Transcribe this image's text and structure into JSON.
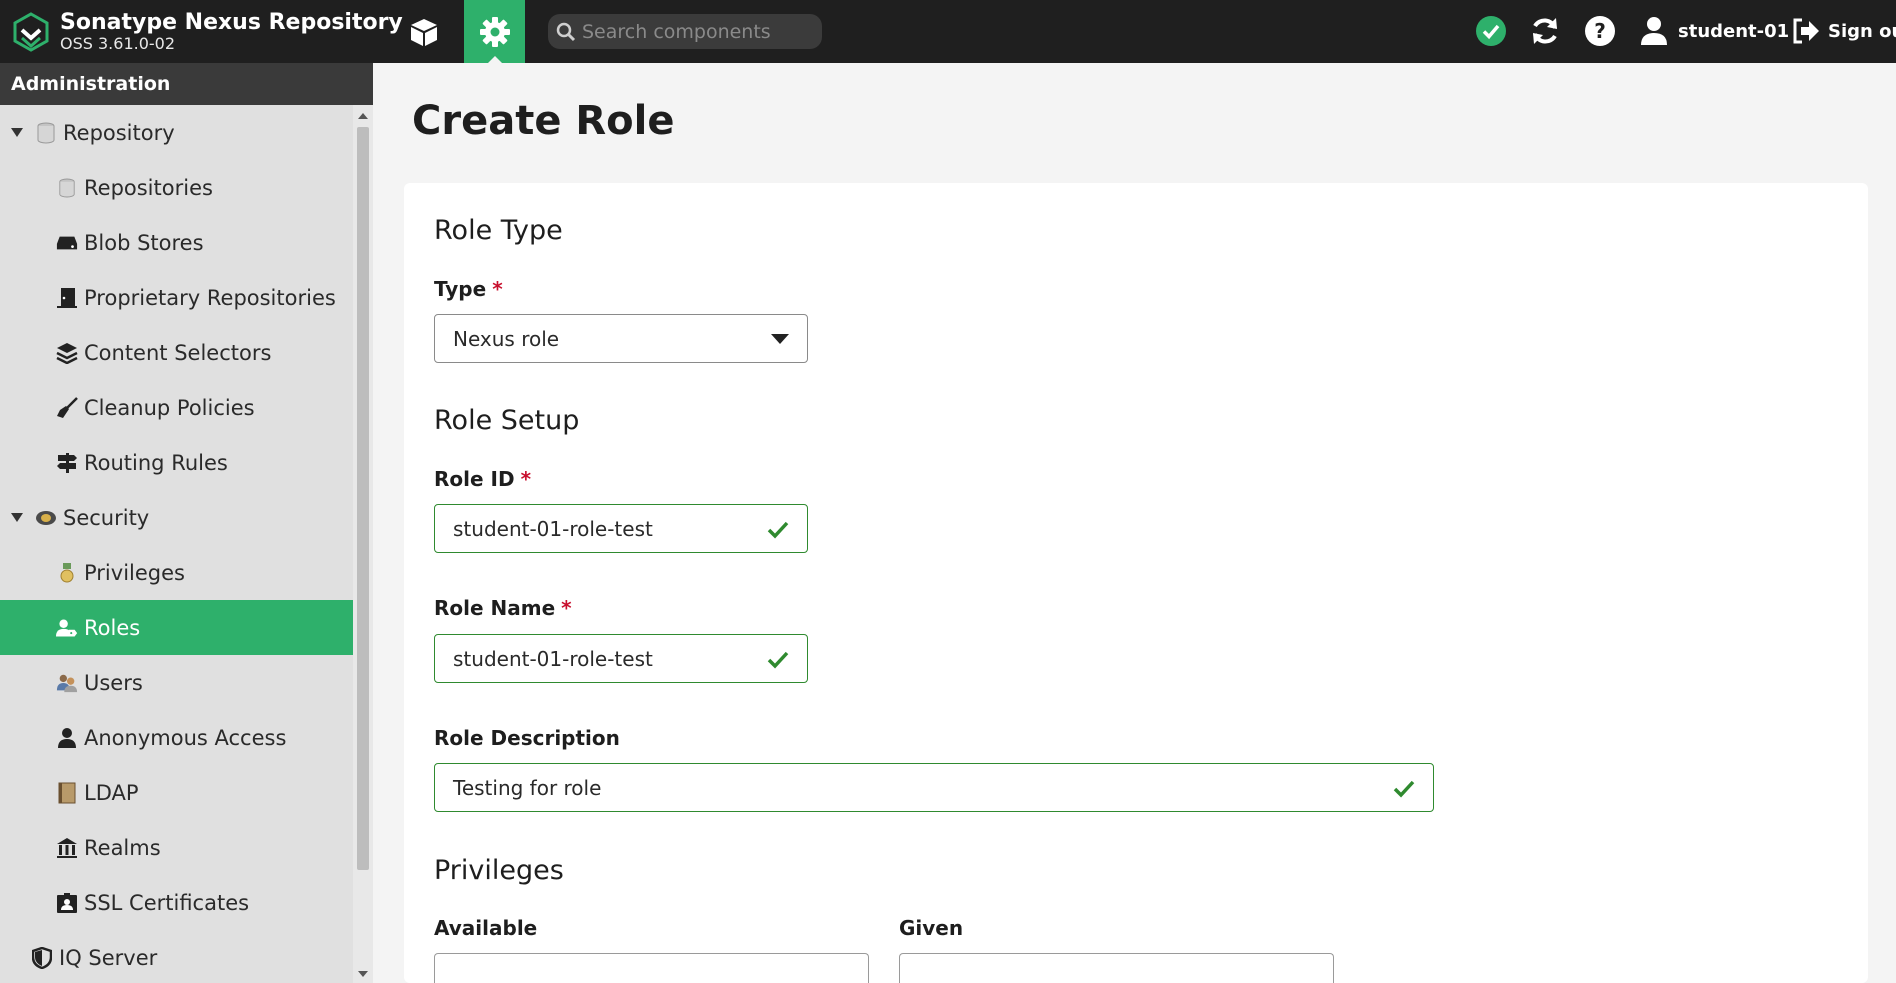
{
  "header": {
    "product_name": "Sonatype Nexus Repository",
    "version": "OSS 3.61.0-02",
    "search_placeholder": "Search components",
    "username": "student-01",
    "sign_out_label": "Sign out",
    "accent_color": "#2eb06b",
    "icons": [
      "browse-cube-icon",
      "admin-gear-icon",
      "search-icon",
      "status-ok-icon",
      "refresh-icon",
      "help-icon",
      "user-icon",
      "sign-out-icon"
    ]
  },
  "sidebar": {
    "title": "Administration",
    "items": [
      {
        "label": "Repository",
        "icon": "database-icon",
        "level": 1
      },
      {
        "label": "Repositories",
        "icon": "database-icon",
        "level": 2
      },
      {
        "label": "Blob Stores",
        "icon": "hard-drive-icon",
        "level": 2
      },
      {
        "label": "Proprietary Repositories",
        "icon": "door-icon",
        "level": 2
      },
      {
        "label": "Content Selectors",
        "icon": "layers-icon",
        "level": 2
      },
      {
        "label": "Cleanup Policies",
        "icon": "broom-icon",
        "level": 2
      },
      {
        "label": "Routing Rules",
        "icon": "signpost-icon",
        "level": 2
      },
      {
        "label": "Security",
        "icon": "badge-icon",
        "level": 1
      },
      {
        "label": "Privileges",
        "icon": "medal-icon",
        "level": 2
      },
      {
        "label": "Roles",
        "icon": "user-tag-icon",
        "level": 2,
        "active": true
      },
      {
        "label": "Users",
        "icon": "users-icon",
        "level": 2
      },
      {
        "label": "Anonymous Access",
        "icon": "user-icon",
        "level": 2
      },
      {
        "label": "LDAP",
        "icon": "book-icon",
        "level": 2
      },
      {
        "label": "Realms",
        "icon": "building-icon",
        "level": 2
      },
      {
        "label": "SSL Certificates",
        "icon": "id-card-icon",
        "level": 2
      },
      {
        "label": "IQ Server",
        "icon": "shield-icon",
        "level": 1
      }
    ]
  },
  "main": {
    "page_title": "Create Role",
    "role_type": {
      "section_title": "Role Type",
      "type_label": "Type",
      "type_value": "Nexus role"
    },
    "role_setup": {
      "section_title": "Role Setup",
      "role_id_label": "Role ID",
      "role_id_value": "student-01-role-test",
      "role_name_label": "Role Name",
      "role_name_value": "student-01-role-test",
      "role_description_label": "Role Description",
      "role_description_value": "Testing for role"
    },
    "privileges": {
      "section_title": "Privileges",
      "available_label": "Available",
      "given_label": "Given"
    },
    "required_marker": "*"
  }
}
